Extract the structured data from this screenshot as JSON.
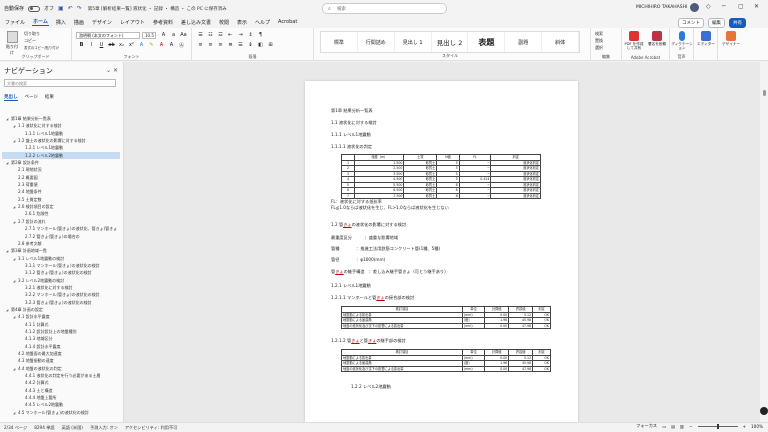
{
  "titlebar": {
    "autosave_label": "自動保存",
    "autosave_state": "オフ",
    "doc_title": "第5章 [解析結果一覧] 液状化 ・ 記録 ・ 構造 ・ この PC に保存済み",
    "search_placeholder": "検索",
    "user_name": "MICHIHIRO TAKAHASHI"
  },
  "menu": {
    "tabs": [
      "ファイル",
      "ホーム",
      "挿入",
      "描画",
      "デザイン",
      "レイアウト",
      "参考資料",
      "差し込み文書",
      "校閲",
      "表示",
      "ヘルプ",
      "Acrobat"
    ],
    "active": "ホーム",
    "comment_label": "コメント",
    "edit_label": "編集",
    "share_label": "共有"
  },
  "ribbon": {
    "paste_label": "貼り付け",
    "cut_label": "切り取り",
    "copy_label": "コピー",
    "format_painter_label": "書式のコピー/貼り付け",
    "clipboard_label": "クリップボード",
    "font_name": "游明朝 (本文のフォント)",
    "font_size": "10.5",
    "font_label": "フォント",
    "paragraph_label": "段落",
    "styles": [
      "標準",
      "行間詰め",
      "見出し 1",
      "見出し 2",
      "表題",
      "副題",
      "斜体"
    ],
    "styles_label": "スタイル",
    "find_label": "検索",
    "replace_label": "置換",
    "select_label": "選択",
    "editing_label": "編集",
    "pdf_create_label": "PDF を作成して共有",
    "pdf_sign_label": "署名を依頼",
    "acrobat_label": "Adobe Acrobat",
    "dictate_label": "ディクテーション",
    "voice_label": "音声",
    "editor_label": "エディター",
    "designer_label": "デザイナー"
  },
  "nav": {
    "title": "ナビゲーション",
    "search_placeholder": "文書の検索",
    "tabs": [
      "見出し",
      "ページ",
      "結果"
    ],
    "items": [
      {
        "t": "第1章 結果分析一覧表",
        "lvl": 0,
        "caret": "◢",
        "sel": false
      },
      {
        "t": "1.1 液状化に対する検討",
        "lvl": 1,
        "caret": "◢",
        "sel": false
      },
      {
        "t": "1.1.1 レベル1地震動",
        "lvl": 2,
        "caret": "",
        "sel": false
      },
      {
        "t": "1.2 盛土の液状化の影響に対する検討",
        "lvl": 1,
        "caret": "◢",
        "sel": false
      },
      {
        "t": "1.2.1 レベル1地震動",
        "lvl": 2,
        "caret": "",
        "sel": false
      },
      {
        "t": "1.2.2 レベル2地震動",
        "lvl": 2,
        "caret": "",
        "sel": true
      },
      {
        "t": "第2章 設計条件",
        "lvl": 0,
        "caret": "◢",
        "sel": false
      },
      {
        "t": "2.1 現地状況",
        "lvl": 1,
        "caret": "",
        "sel": false
      },
      {
        "t": "2.2 概要図",
        "lvl": 1,
        "caret": "",
        "sel": false
      },
      {
        "t": "2.3 荷重値",
        "lvl": 1,
        "caret": "",
        "sel": false
      },
      {
        "t": "2.4 地盤条件",
        "lvl": 1,
        "caret": "",
        "sel": false
      },
      {
        "t": "2.5 土質定数",
        "lvl": 1,
        "caret": "",
        "sel": false
      },
      {
        "t": "2.6 検討項目の設定",
        "lvl": 1,
        "caret": "◢",
        "sel": false
      },
      {
        "t": "2.6.1 危険性",
        "lvl": 2,
        "caret": "",
        "sel": false
      },
      {
        "t": "2.7 設計の流れ",
        "lvl": 1,
        "caret": "◢",
        "sel": false
      },
      {
        "t": "2.7.1 マンホール(管きょ)の液状化、管きょ(管きょ",
        "lvl": 2,
        "caret": "",
        "sel": false
      },
      {
        "t": "2.7.2 管きょ(管きょ)の場合の",
        "lvl": 2,
        "caret": "",
        "sel": false
      },
      {
        "t": "2.8 参考文献",
        "lvl": 1,
        "caret": "",
        "sel": false
      },
      {
        "t": "第3章 計画地域一覧",
        "lvl": 0,
        "caret": "◢",
        "sel": false
      },
      {
        "t": "3.1 レベル1地震動の検討",
        "lvl": 1,
        "caret": "◢",
        "sel": false
      },
      {
        "t": "3.1.1 マンホール(管きょ)の液状化の検討",
        "lvl": 2,
        "caret": "",
        "sel": false
      },
      {
        "t": "3.1.2 管きょ(管きょ)の液状化の検討",
        "lvl": 2,
        "caret": "",
        "sel": false
      },
      {
        "t": "3.2 レベル2地震動の検討",
        "lvl": 1,
        "caret": "◢",
        "sel": false
      },
      {
        "t": "3.2.1 液状化に対する検討",
        "lvl": 2,
        "caret": "",
        "sel": false
      },
      {
        "t": "3.2.2 マンホール(管きょ)の液状化の検討",
        "lvl": 2,
        "caret": "",
        "sel": false
      },
      {
        "t": "3.2.3 管きょ(管きょ)の液状化の検討",
        "lvl": 2,
        "caret": "",
        "sel": false
      },
      {
        "t": "第4章 計画の設定",
        "lvl": 0,
        "caret": "◢",
        "sel": false
      },
      {
        "t": "4.1 設計水平震度",
        "lvl": 1,
        "caret": "◢",
        "sel": false
      },
      {
        "t": "4.1.1 計算式",
        "lvl": 2,
        "caret": "",
        "sel": false
      },
      {
        "t": "4.1.2 設計設計上の地盤種別",
        "lvl": 2,
        "caret": "",
        "sel": false
      },
      {
        "t": "4.1.3 地域区分",
        "lvl": 2,
        "caret": "",
        "sel": false
      },
      {
        "t": "4.1.4 設計水平震度",
        "lvl": 2,
        "caret": "",
        "sel": false
      },
      {
        "t": "4.2 地盤面の最大加速度",
        "lvl": 1,
        "caret": "",
        "sel": false
      },
      {
        "t": "4.3 地盤振動の速度",
        "lvl": 1,
        "caret": "",
        "sel": false
      },
      {
        "t": "4.4 地盤の液状化の判定",
        "lvl": 1,
        "caret": "◢",
        "sel": false
      },
      {
        "t": "4.4.1 液状化の判定を行う必要がある土層",
        "lvl": 2,
        "caret": "",
        "sel": false
      },
      {
        "t": "4.4.2 計算式",
        "lvl": 2,
        "caret": "",
        "sel": false
      },
      {
        "t": "4.4.3 土と構造",
        "lvl": 2,
        "caret": "",
        "sel": false
      },
      {
        "t": "4.4.4 地盤上箇所",
        "lvl": 2,
        "caret": "",
        "sel": false
      },
      {
        "t": "4.4.5 レベル2地震動",
        "lvl": 2,
        "caret": "",
        "sel": false
      },
      {
        "t": "4.5 マンホール(管きょ)の液状化の検討",
        "lvl": 1,
        "caret": "◢",
        "sel": false
      }
    ]
  },
  "doc": {
    "h1": "第1章 結果分析一覧表",
    "h2_1": "1.1 液状化に対する検討",
    "h3_1": "1.1.1 レベル1地震動",
    "h4_1": "1.1.1.1 液状化の判定",
    "table1_header": [
      "",
      "深度（m）",
      "土質",
      "N値",
      "FL",
      "判定"
    ],
    "table1_rows": [
      [
        "1",
        "1.500",
        "砂質土",
        "5",
        "─",
        "液状化判定"
      ],
      [
        "2",
        "2.500",
        "砂質土",
        "5",
        "─",
        "液状化判定"
      ],
      [
        "3",
        "3.500",
        "砂質土",
        "5",
        "─",
        "液状化判定"
      ],
      [
        "4",
        "4.500",
        "砂質土",
        "5",
        "0.424",
        "液状化判定"
      ],
      [
        "5",
        "5.500",
        "砂質土",
        "8",
        "─",
        "液状化判定"
      ],
      [
        "6",
        "6.500",
        "砂質土",
        "8",
        "─",
        "液状化判定"
      ],
      [
        "7",
        "7.500",
        "砂質土",
        "8",
        "─",
        "液状化判定"
      ]
    ],
    "note1": "FL：液状化に対する抵抗率",
    "note2": "FL≦1.0ならば液状化を生じ、FL>1.0ならば液状化を生じない",
    "h2_2a": "1.2 管",
    "h2_2red": "きょ",
    "h2_2b": "の液状化の影響に対する検討",
    "prop1_k": "最重度区分",
    "prop1_v": "：盛重な影響地域",
    "prop2_k": "管種",
    "prop2_v": "：推進工法用鉄筋コンクリート管(1種、5種)",
    "prop3_k": "管径",
    "prop3_v": "：φ1000(mm)",
    "prop4_a": "管",
    "prop4_red": "きょ",
    "prop4_b": "の継手構造　：差し込み継手管きょ（可とう継手あり）",
    "h3_2": "1.2.1 レベル1地震動",
    "h4_2a": "1.2.1.1 マンホールと管",
    "h4_2red": "きょ",
    "h4_2b": "の接合部の検討",
    "table2_header": [
      "検討項目",
      "単位",
      "計算値",
      "許容値",
      "判定"
    ],
    "table2_rows": [
      [
        "地震動による抜出量",
        "(mm)",
        "0.00",
        "5.12",
        "OK"
      ],
      [
        "地震動による屈曲角",
        "(度)",
        "1.96",
        "45.98",
        "OK"
      ],
      [
        "地盤の液状化及び沈下の影響による抜出量",
        "(mm)",
        "0.00",
        "47.98",
        "OK"
      ]
    ],
    "h4_3a": "1.2.1.2 管",
    "h4_3red": "きょ",
    "h4_3b": "と管",
    "h4_3red2": "きょ",
    "h4_3c": "の継手部の検討",
    "table3_header": [
      "検討項目",
      "単位",
      "計算値",
      "許容値",
      "判定"
    ],
    "table3_rows": [
      [
        "地震動による抜出量",
        "(mm)",
        "0.00",
        "5.12",
        "OK"
      ],
      [
        "地震動による屈曲角",
        "(度)",
        "1.96",
        "45.98",
        "OK"
      ],
      [
        "地盤の液状化及び沈下の影響による抜出量",
        "(mm)",
        "0.00",
        "47.98",
        "OK"
      ]
    ],
    "h3_3": "1.2.2 レベル2地震動"
  },
  "status": {
    "page": "2/34 ページ",
    "words": "8294 単語",
    "lang": "英語 (米国)",
    "input": "予測入力: オン",
    "accessibility": "アクセシビリティ: 利用不可",
    "focus": "フォーカス",
    "zoom": "100%"
  },
  "colors": {
    "accent": "#185abd",
    "nav_selected": "#c7dcf3",
    "red_text": "#c00000"
  }
}
